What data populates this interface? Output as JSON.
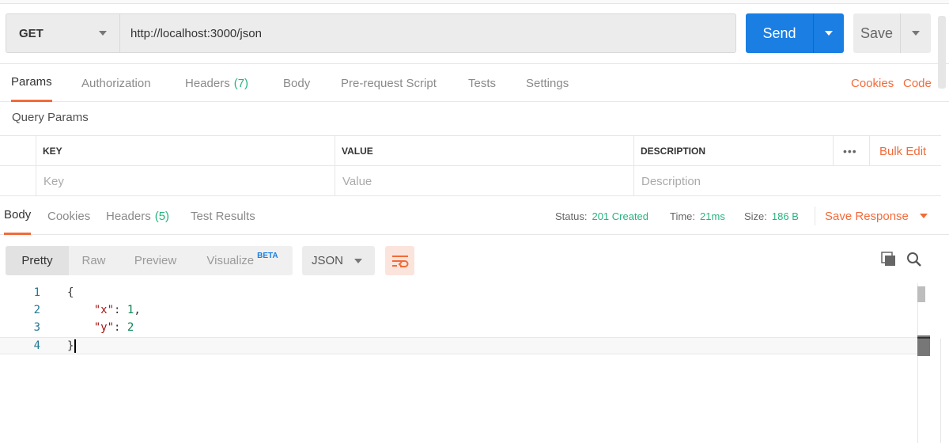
{
  "request": {
    "method": "GET",
    "url": "http://localhost:3000/json",
    "send_label": "Send",
    "save_label": "Save"
  },
  "request_tabs": [
    {
      "label": "Params",
      "active": true
    },
    {
      "label": "Authorization"
    },
    {
      "label": "Headers",
      "count": "(7)"
    },
    {
      "label": "Body"
    },
    {
      "label": "Pre-request Script"
    },
    {
      "label": "Tests"
    },
    {
      "label": "Settings"
    }
  ],
  "links": {
    "cookies": "Cookies",
    "code": "Code"
  },
  "query_params": {
    "title": "Query Params",
    "columns": [
      "KEY",
      "VALUE",
      "DESCRIPTION"
    ],
    "more": "•••",
    "bulk_edit": "Bulk Edit",
    "placeholders": [
      "Key",
      "Value",
      "Description"
    ]
  },
  "response_tabs": [
    {
      "label": "Body",
      "active": true
    },
    {
      "label": "Cookies"
    },
    {
      "label": "Headers",
      "count": "(5)"
    },
    {
      "label": "Test Results"
    }
  ],
  "response_meta": {
    "status_label": "Status:",
    "status": "201 Created",
    "time_label": "Time:",
    "time": "21ms",
    "size_label": "Size:",
    "size": "186 B",
    "save_response": "Save Response"
  },
  "view_modes": [
    "Pretty",
    "Raw",
    "Preview",
    "Visualize"
  ],
  "beta": "BETA",
  "format": "JSON",
  "icons": {
    "wrap": "wrap-lines-icon",
    "copy": "copy-icon",
    "search": "search-icon"
  },
  "colors": {
    "send": "#1a7ee3",
    "accent": "#f26b3a",
    "success": "#26b47f"
  },
  "code": {
    "line_numbers": [
      "1",
      "2",
      "3",
      "4"
    ],
    "open": "{",
    "key_x": "\"x\"",
    "val_x": "1",
    "key_y": "\"y\"",
    "val_y": "2",
    "close": "}"
  }
}
